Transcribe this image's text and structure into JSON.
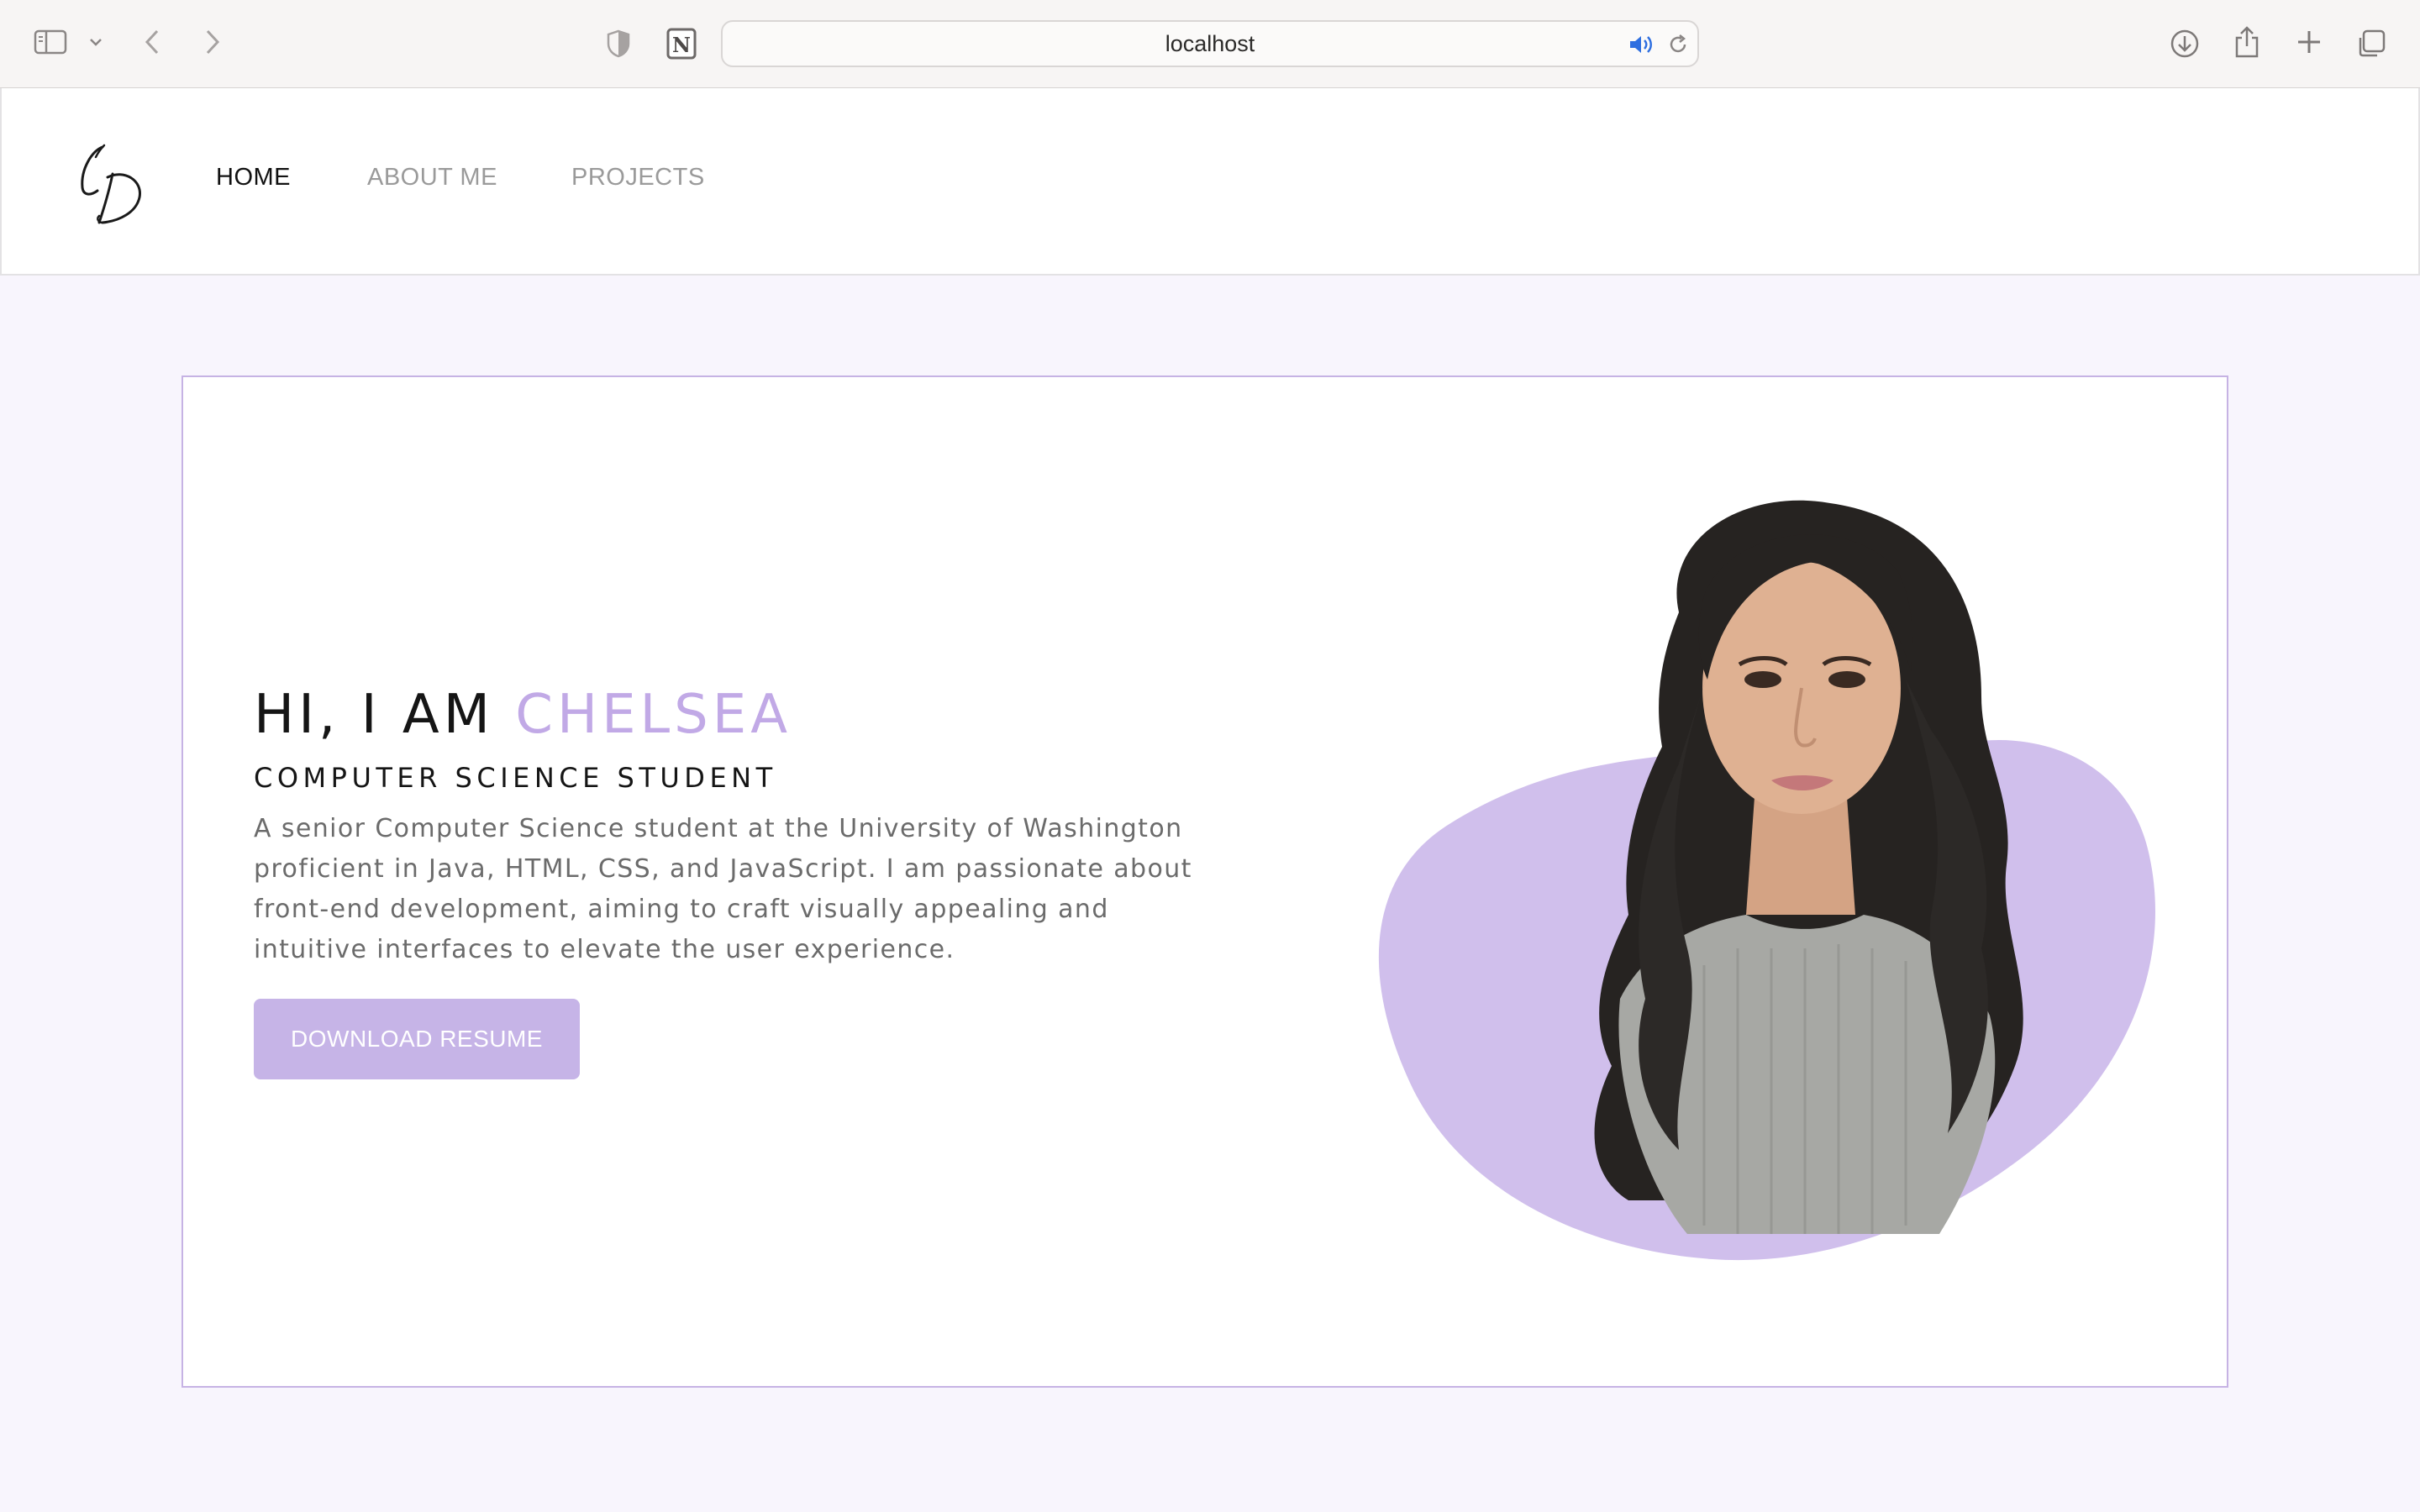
{
  "browser": {
    "url": "localhost",
    "icons": {
      "sidebar": "sidebar-icon",
      "sidebar_menu": "chevron-down-icon",
      "back": "chevron-left-icon",
      "forward": "chevron-right-icon",
      "privacy": "shield-half-icon",
      "notion": "notion-icon",
      "audio": "speaker-icon",
      "reload": "reload-icon",
      "downloads": "download-icon",
      "share": "share-icon",
      "new_tab": "plus-icon",
      "tabs": "tabs-overview-icon"
    }
  },
  "nav": {
    "logo": "CD monogram logo",
    "items": [
      {
        "label": "HOME",
        "active": true
      },
      {
        "label": "ABOUT ME",
        "active": false
      },
      {
        "label": "PROJECTS",
        "active": false
      }
    ]
  },
  "hero": {
    "greeting": "HI, I AM",
    "name": "CHELSEA",
    "subtitle": "COMPUTER SCIENCE STUDENT",
    "description": "A senior Computer Science student at the University of Washington proficient in Java, HTML, CSS, and JavaScript. I am passionate about front-end development, aiming to craft visually appealing and intuitive interfaces to elevate the user experience.",
    "button_label": "DOWNLOAD RESUME"
  },
  "colors": {
    "accent": "#c1a9e6",
    "blob": "#d0bfec",
    "button": "#c6b4e7",
    "card_border": "#c6b3e4",
    "page_bg": "#f8f5fd",
    "text_dark": "#151515",
    "text_muted": "#6b6b6b"
  }
}
